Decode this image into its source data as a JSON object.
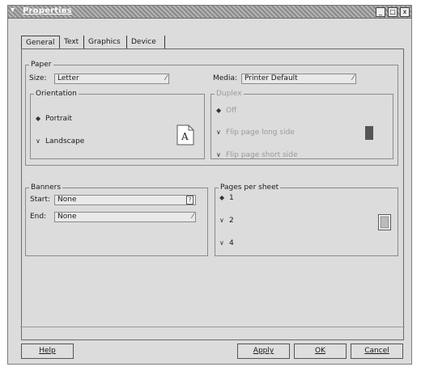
{
  "window": {
    "title": "Properties",
    "menu_glyph": "▾",
    "title_buttons": [
      "_",
      "□",
      "x"
    ]
  },
  "tabs": [
    {
      "label": "General",
      "active": true
    },
    {
      "label": "Text",
      "active": false
    },
    {
      "label": "Graphics",
      "active": false
    },
    {
      "label": "Device",
      "active": false
    }
  ],
  "paper": {
    "legend": "Paper",
    "size_label": "Size:",
    "size_value": "Letter",
    "media_label": "Media:",
    "media_value": "Printer Default"
  },
  "orientation": {
    "legend": "Orientation",
    "options": [
      {
        "label": "Portrait",
        "selected": true
      },
      {
        "label": "Landscape",
        "selected": false
      }
    ],
    "preview_glyph": "A"
  },
  "duplex": {
    "legend": "Duplex",
    "enabled": false,
    "options": [
      {
        "label": "Off",
        "selected": true
      },
      {
        "label": "Flip page long side",
        "selected": false
      },
      {
        "label": "Flip page short side",
        "selected": false
      }
    ]
  },
  "banners": {
    "legend": "Banners",
    "start_label": "Start:",
    "start_value": "None",
    "end_label": "End:",
    "end_value": "None"
  },
  "pages_per_sheet": {
    "legend": "Pages per sheet",
    "options": [
      {
        "label": "1",
        "selected": true
      },
      {
        "label": "2",
        "selected": false
      },
      {
        "label": "4",
        "selected": false
      }
    ]
  },
  "buttons": {
    "help": "Help",
    "apply": "Apply",
    "ok": "OK",
    "cancel": "Cancel"
  }
}
